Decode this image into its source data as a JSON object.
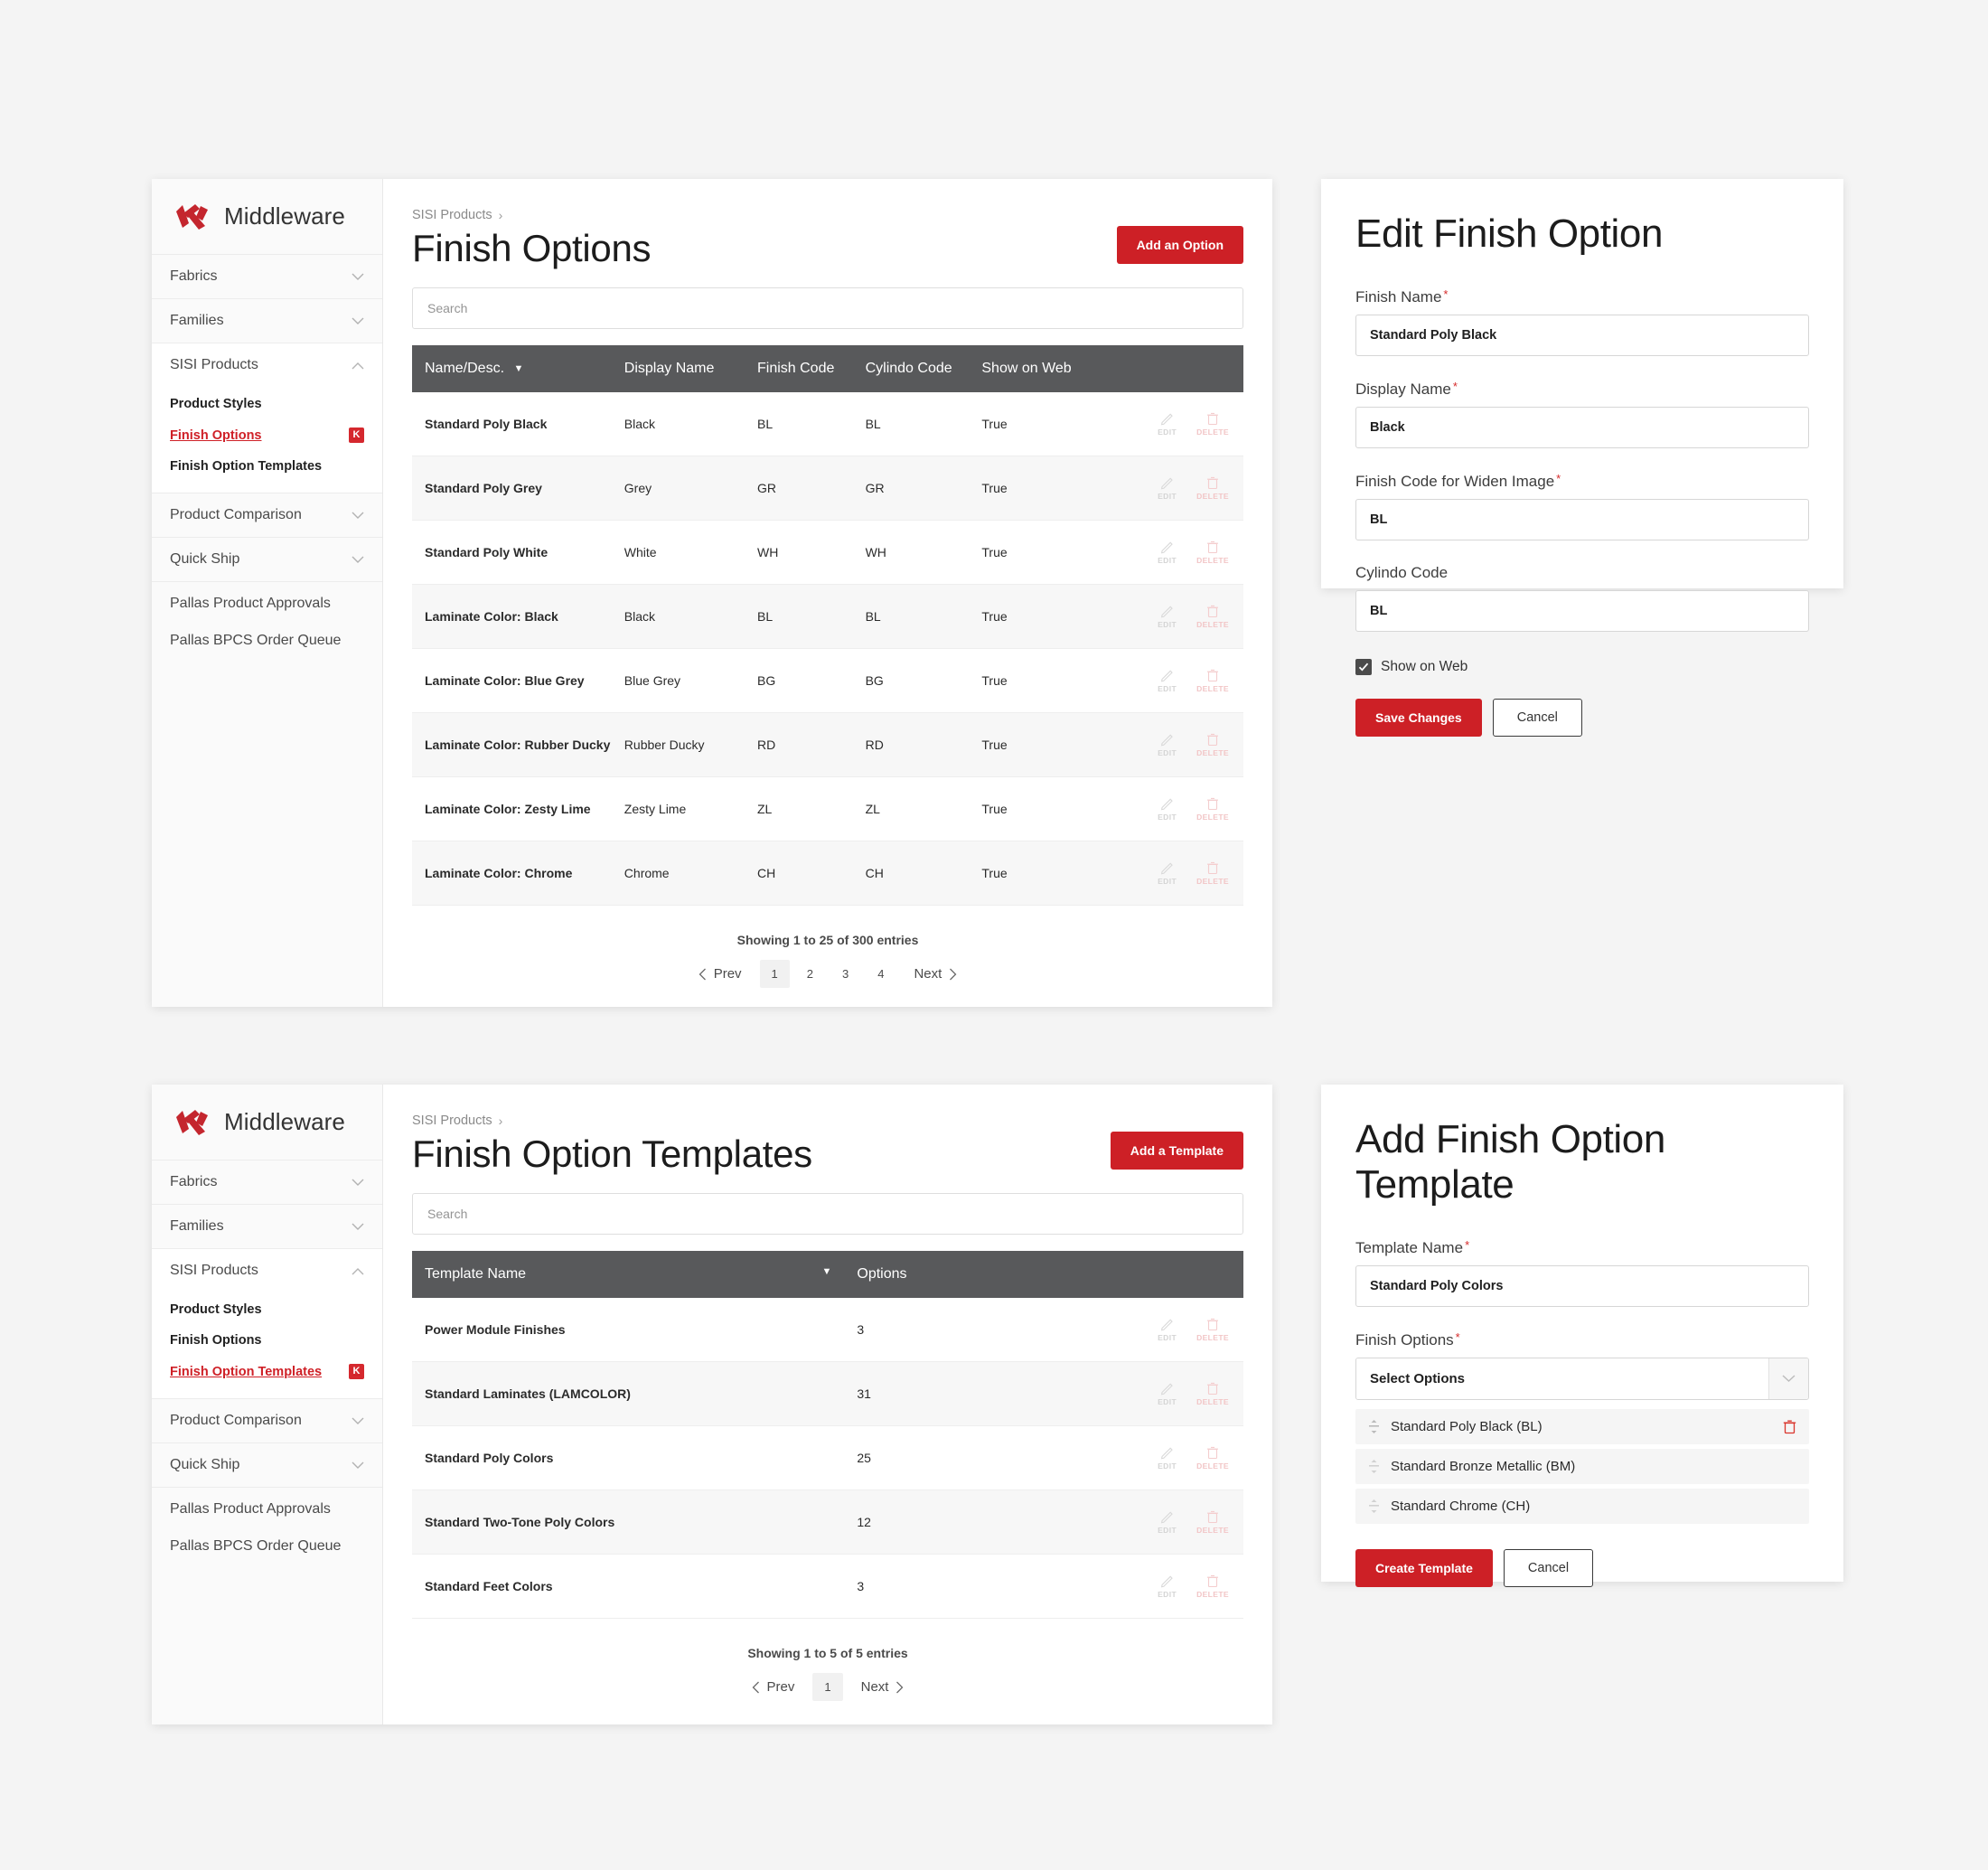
{
  "brand": {
    "name": "Middleware",
    "logo_icon": "ki-logo"
  },
  "colors": {
    "accent_red": "#cd2026",
    "header_grey": "#58595b",
    "page_bg": "#f4f4f4"
  },
  "sidebar_top": {
    "groups": [
      {
        "label": "Fabrics",
        "icon": "chevron-down-icon"
      },
      {
        "label": "Families",
        "icon": "chevron-down-icon"
      },
      {
        "label": "SISI Products",
        "icon": "chevron-up-icon"
      }
    ],
    "sub_items": [
      {
        "label": "Product Styles",
        "active": false,
        "badge": ""
      },
      {
        "label": "Finish Options",
        "active": true,
        "badge": "K"
      },
      {
        "label": "Finish Option Templates",
        "active": false,
        "badge": ""
      }
    ],
    "groups_after": [
      {
        "label": "Product Comparison",
        "icon": "chevron-down-icon"
      },
      {
        "label": "Quick Ship",
        "icon": "chevron-down-icon"
      }
    ],
    "plain_items": [
      {
        "label": "Pallas Product Approvals"
      },
      {
        "label": "Pallas BPCS Order Queue"
      }
    ]
  },
  "sidebar_bottom": {
    "groups": [
      {
        "label": "Fabrics",
        "icon": "chevron-down-icon"
      },
      {
        "label": "Families",
        "icon": "chevron-down-icon"
      },
      {
        "label": "SISI Products",
        "icon": "chevron-up-icon"
      }
    ],
    "sub_items": [
      {
        "label": "Product Styles",
        "active": false,
        "badge": ""
      },
      {
        "label": "Finish Options",
        "active": false,
        "badge": ""
      },
      {
        "label": "Finish Option Templates",
        "active": true,
        "badge": "K"
      }
    ],
    "groups_after": [
      {
        "label": "Product Comparison",
        "icon": "chevron-down-icon"
      },
      {
        "label": "Quick Ship",
        "icon": "chevron-down-icon"
      }
    ],
    "plain_items": [
      {
        "label": "Pallas Product Approvals"
      },
      {
        "label": "Pallas BPCS Order Queue"
      }
    ]
  },
  "finish_options_page": {
    "breadcrumb": "SISI Products",
    "breadcrumb_arrow": "›",
    "title": "Finish Options",
    "add_button": "Add an Option",
    "search_placeholder": "Search",
    "columns": [
      "Name/Desc.",
      "Display Name",
      "Finish Code",
      "Cylindo Code",
      "Show on Web"
    ],
    "sort_caret": "▼",
    "rows": [
      {
        "name": "Standard Poly Black",
        "display": "Black",
        "finish": "BL",
        "cylindo": "BL",
        "web": "True"
      },
      {
        "name": "Standard Poly Grey",
        "display": "Grey",
        "finish": "GR",
        "cylindo": "GR",
        "web": "True"
      },
      {
        "name": "Standard Poly White",
        "display": "White",
        "finish": "WH",
        "cylindo": "WH",
        "web": "True"
      },
      {
        "name": "Laminate Color: Black",
        "display": "Black",
        "finish": "BL",
        "cylindo": "BL",
        "web": "True"
      },
      {
        "name": "Laminate Color: Blue Grey",
        "display": "Blue Grey",
        "finish": "BG",
        "cylindo": "BG",
        "web": "True"
      },
      {
        "name": "Laminate Color: Rubber Ducky",
        "display": "Rubber Ducky",
        "finish": "RD",
        "cylindo": "RD",
        "web": "True"
      },
      {
        "name": "Laminate Color: Zesty Lime",
        "display": "Zesty Lime",
        "finish": "ZL",
        "cylindo": "ZL",
        "web": "True"
      },
      {
        "name": "Laminate Color: Chrome",
        "display": "Chrome",
        "finish": "CH",
        "cylindo": "CH",
        "web": "True"
      }
    ],
    "row_actions": {
      "edit": "EDIT",
      "delete": "DELETE"
    },
    "showing": "Showing 1 to 25 of 300 entries",
    "pager": {
      "prev": "Prev",
      "next": "Next",
      "pages": [
        "1",
        "2",
        "3",
        "4"
      ],
      "current": "1"
    }
  },
  "templates_page": {
    "breadcrumb": "SISI Products",
    "breadcrumb_arrow": "›",
    "title": "Finish Option Templates",
    "add_button": "Add a Template",
    "search_placeholder": "Search",
    "columns": [
      "Template Name",
      "Options"
    ],
    "sort_caret": "▼",
    "rows": [
      {
        "name": "Power Module Finishes",
        "options": "3"
      },
      {
        "name": "Standard Laminates (LAMCOLOR)",
        "options": "31"
      },
      {
        "name": "Standard Poly Colors",
        "options": "25"
      },
      {
        "name": "Standard Two-Tone Poly Colors",
        "options": "12"
      },
      {
        "name": "Standard Feet Colors",
        "options": "3"
      }
    ],
    "row_actions": {
      "edit": "EDIT",
      "delete": "DELETE"
    },
    "showing": "Showing 1 to 5 of 5 entries",
    "pager": {
      "prev": "Prev",
      "next": "Next",
      "pages": [
        "1"
      ],
      "current": "1"
    }
  },
  "edit_finish_option": {
    "title": "Edit Finish Option",
    "fields": [
      {
        "label": "Finish Name",
        "required": true,
        "value": "Standard Poly Black"
      },
      {
        "label": "Display Name",
        "required": true,
        "value": "Black"
      },
      {
        "label": "Finish Code for Widen Image",
        "required": true,
        "value": "BL"
      },
      {
        "label": "Cylindo Code",
        "required": false,
        "value": "BL"
      }
    ],
    "checkbox": {
      "label": "Show on Web",
      "checked": true
    },
    "save_label": "Save Changes",
    "cancel_label": "Cancel"
  },
  "add_template": {
    "title": "Add Finish Option Template",
    "name_label": "Template Name",
    "name_value": "Standard Poly Colors",
    "options_label": "Finish Options",
    "select_placeholder": "Select Options",
    "selected_options": [
      {
        "label": "Standard Poly Black (BL)",
        "has_delete": true
      },
      {
        "label": "Standard Bronze Metallic (BM)",
        "has_delete": false
      },
      {
        "label": "Standard Chrome (CH)",
        "has_delete": false
      }
    ],
    "create_label": "Create Template",
    "cancel_label": "Cancel"
  }
}
